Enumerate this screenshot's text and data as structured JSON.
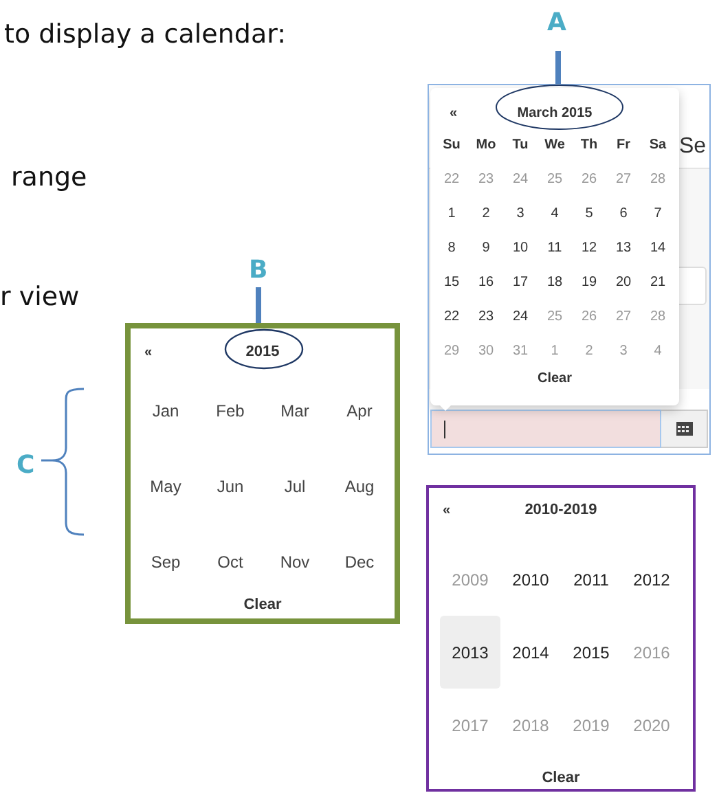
{
  "text_lines": [
    "to display a calendar:",
    "range",
    "r view"
  ],
  "callouts": [
    {
      "label": "A"
    },
    {
      "label": "B"
    },
    {
      "label": "C"
    }
  ],
  "day_view": {
    "prev": "«",
    "title": "March 2015",
    "background_text": "Se",
    "weekdays": [
      "Su",
      "Mo",
      "Tu",
      "We",
      "Th",
      "Fr",
      "Sa"
    ],
    "weeks": [
      [
        {
          "day": "22",
          "muted": true
        },
        {
          "day": "23",
          "muted": true
        },
        {
          "day": "24",
          "muted": true
        },
        {
          "day": "25",
          "muted": true
        },
        {
          "day": "26",
          "muted": true
        },
        {
          "day": "27",
          "muted": true
        },
        {
          "day": "28",
          "muted": true
        }
      ],
      [
        {
          "day": "1",
          "muted": false
        },
        {
          "day": "2",
          "muted": false
        },
        {
          "day": "3",
          "muted": false
        },
        {
          "day": "4",
          "muted": false
        },
        {
          "day": "5",
          "muted": false
        },
        {
          "day": "6",
          "muted": false
        },
        {
          "day": "7",
          "muted": false
        }
      ],
      [
        {
          "day": "8",
          "muted": false
        },
        {
          "day": "9",
          "muted": false
        },
        {
          "day": "10",
          "muted": false
        },
        {
          "day": "11",
          "muted": false
        },
        {
          "day": "12",
          "muted": false
        },
        {
          "day": "13",
          "muted": false
        },
        {
          "day": "14",
          "muted": false
        }
      ],
      [
        {
          "day": "15",
          "muted": false
        },
        {
          "day": "16",
          "muted": false
        },
        {
          "day": "17",
          "muted": false
        },
        {
          "day": "18",
          "muted": false
        },
        {
          "day": "19",
          "muted": false
        },
        {
          "day": "20",
          "muted": false
        },
        {
          "day": "21",
          "muted": false
        }
      ],
      [
        {
          "day": "22",
          "muted": false
        },
        {
          "day": "23",
          "muted": false
        },
        {
          "day": "24",
          "muted": false
        },
        {
          "day": "25",
          "muted": true
        },
        {
          "day": "26",
          "muted": true
        },
        {
          "day": "27",
          "muted": true
        },
        {
          "day": "28",
          "muted": true
        }
      ],
      [
        {
          "day": "29",
          "muted": true
        },
        {
          "day": "30",
          "muted": true
        },
        {
          "day": "31",
          "muted": true
        },
        {
          "day": "1",
          "muted": true
        },
        {
          "day": "2",
          "muted": true
        },
        {
          "day": "3",
          "muted": true
        },
        {
          "day": "4",
          "muted": true
        }
      ]
    ],
    "clear": "Clear",
    "date_field": {
      "invalid": true
    }
  },
  "month_view": {
    "prev": "«",
    "title": "2015",
    "months": [
      "Jan",
      "Feb",
      "Mar",
      "Apr",
      "May",
      "Jun",
      "Jul",
      "Aug",
      "Sep",
      "Oct",
      "Nov",
      "Dec"
    ],
    "clear": "Clear"
  },
  "year_view": {
    "prev": "«",
    "title": "2010-2019",
    "years": [
      {
        "label": "2009",
        "muted": true,
        "selected": false
      },
      {
        "label": "2010",
        "muted": false,
        "selected": false
      },
      {
        "label": "2011",
        "muted": false,
        "selected": false
      },
      {
        "label": "2012",
        "muted": false,
        "selected": false
      },
      {
        "label": "2013",
        "muted": false,
        "selected": true
      },
      {
        "label": "2014",
        "muted": false,
        "selected": false
      },
      {
        "label": "2015",
        "muted": false,
        "selected": false
      },
      {
        "label": "2016",
        "muted": true,
        "selected": false
      },
      {
        "label": "2017",
        "muted": true,
        "selected": false
      },
      {
        "label": "2018",
        "muted": true,
        "selected": false
      },
      {
        "label": "2019",
        "muted": true,
        "selected": false
      },
      {
        "label": "2020",
        "muted": true,
        "selected": false
      }
    ],
    "clear": "Clear"
  }
}
